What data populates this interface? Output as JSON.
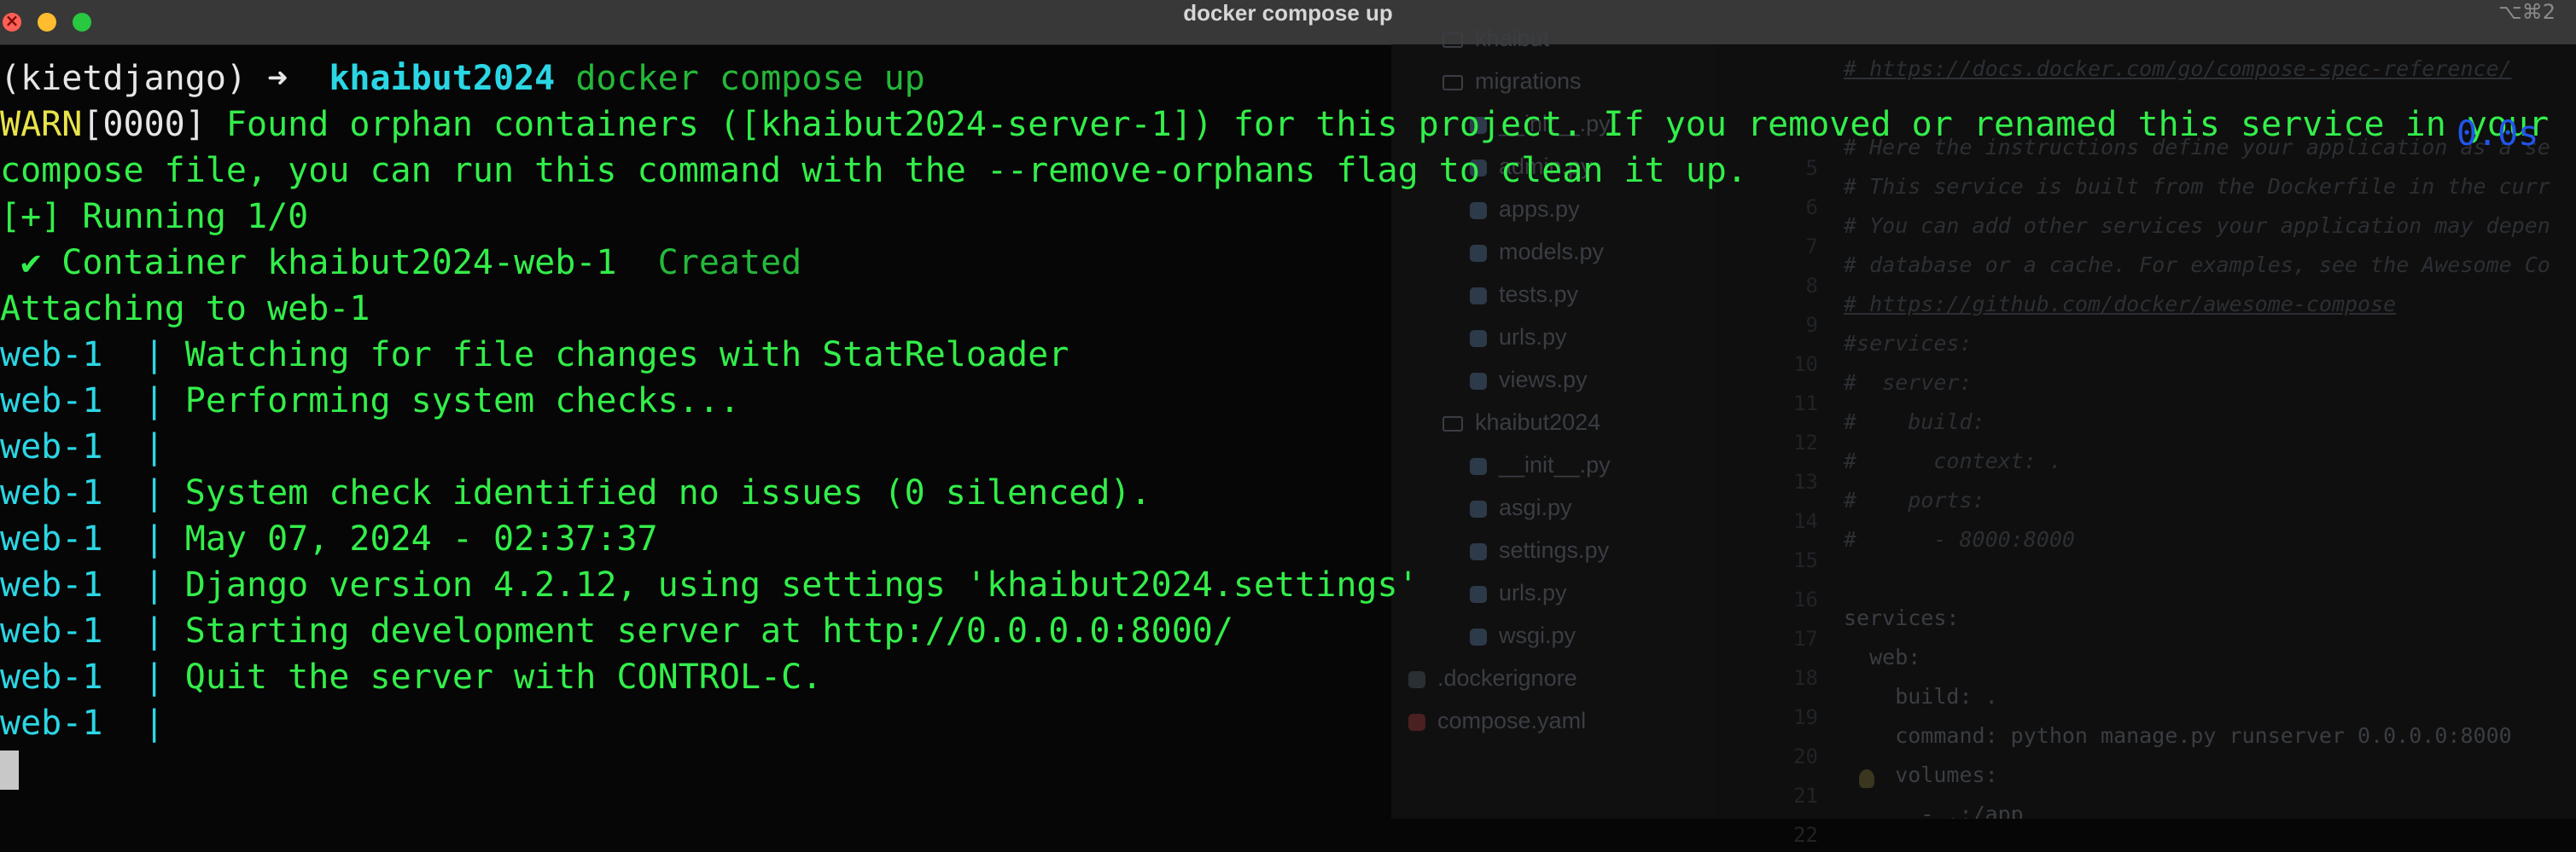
{
  "window": {
    "title": "docker compose up",
    "shortcut": "⌥⌘2"
  },
  "terminal": {
    "prompt_env": "(kietdjango)",
    "prompt_arrow": "➜",
    "prompt_dir": "khaibut2024",
    "command": "docker compose up",
    "warn_tag": "WARN",
    "warn_code": "[0000]",
    "warn_text_1": " Found orphan containers ([khaibut2024-server-1]) for this project. If you removed or renamed this service in your",
    "warn_text_2": "compose file, you can run this command with the --remove-orphans flag to clean it up.",
    "running": "[+] Running 1/0",
    "check_mark": "✔",
    "container_label": "Container khaibut2024-web-1",
    "container_status": "Created",
    "timer": "0.0s",
    "attaching": "Attaching to web-1",
    "log_prefix": "web-1  | ",
    "log_lines": [
      "Watching for file changes with StatReloader",
      "Performing system checks...",
      "",
      "System check identified no issues (0 silenced).",
      "May 07, 2024 - 02:37:37",
      "Django version 4.2.12, using settings 'khaibut2024.settings'",
      "Starting development server at http://0.0.0.0:8000/",
      "Quit the server with CONTROL-C.",
      ""
    ]
  },
  "background_editor": {
    "tree": [
      {
        "name": "khaibut",
        "icon": "folder-icon"
      },
      {
        "name": "migrations",
        "icon": "folder-icon"
      },
      {
        "name": "__init__.py",
        "icon": "python-file-icon"
      },
      {
        "name": "admin.py",
        "icon": "python-file-icon"
      },
      {
        "name": "apps.py",
        "icon": "python-file-icon"
      },
      {
        "name": "models.py",
        "icon": "python-file-icon"
      },
      {
        "name": "tests.py",
        "icon": "python-file-icon"
      },
      {
        "name": "urls.py",
        "icon": "python-file-icon"
      },
      {
        "name": "views.py",
        "icon": "python-file-icon"
      },
      {
        "name": "khaibut2024",
        "icon": "folder-icon"
      },
      {
        "name": "__init__.py",
        "icon": "python-file-icon"
      },
      {
        "name": "asgi.py",
        "icon": "python-file-icon"
      },
      {
        "name": "settings.py",
        "icon": "python-file-icon"
      },
      {
        "name": "urls.py",
        "icon": "python-file-icon"
      },
      {
        "name": "wsgi.py",
        "icon": "python-file-icon"
      },
      {
        "name": ".dockerignore",
        "icon": "docker-file-icon"
      },
      {
        "name": "compose.yaml",
        "icon": "yaml-file-icon"
      }
    ],
    "line_numbers": [
      "5",
      "6",
      "7",
      "8",
      "9",
      "10",
      "11",
      "12",
      "13",
      "14",
      "15",
      "16",
      "17",
      "18",
      "19",
      "20",
      "21",
      "22"
    ],
    "code_lines": [
      {
        "text": "# https://docs.docker.com/go/compose-spec-reference/",
        "kind": "link"
      },
      {
        "text": "",
        "kind": "comment"
      },
      {
        "text": "# Here the instructions define your application as a se",
        "kind": "comment"
      },
      {
        "text": "# This service is built from the Dockerfile in the curr",
        "kind": "comment"
      },
      {
        "text": "# You can add other services your application may depen",
        "kind": "comment"
      },
      {
        "text": "# database or a cache. For examples, see the Awesome Co",
        "kind": "comment"
      },
      {
        "text": "# https://github.com/docker/awesome-compose",
        "kind": "link"
      },
      {
        "text": "#services:",
        "kind": "comment"
      },
      {
        "text": "#  server:",
        "kind": "comment"
      },
      {
        "text": "#    build:",
        "kind": "comment"
      },
      {
        "text": "#      context: .",
        "kind": "comment"
      },
      {
        "text": "#    ports:",
        "kind": "comment"
      },
      {
        "text": "#      - 8000:8000",
        "kind": "comment"
      },
      {
        "text": "",
        "kind": "plain"
      },
      {
        "text": "services:",
        "kind": "plain"
      },
      {
        "text": "  web:",
        "kind": "plain"
      },
      {
        "text": "    build: .",
        "kind": "plain"
      },
      {
        "text": "    command: python manage.py runserver 0.0.0.0:8000",
        "kind": "plain"
      },
      {
        "text": "    volumes:",
        "kind": "plain"
      },
      {
        "text": "      - .:/app",
        "kind": "plain"
      }
    ]
  },
  "colors": {
    "green": "#33ee4a",
    "cyan": "#2bd6e4",
    "yellow": "#e8e44a",
    "blue": "#2255ee",
    "background": "#060606"
  }
}
